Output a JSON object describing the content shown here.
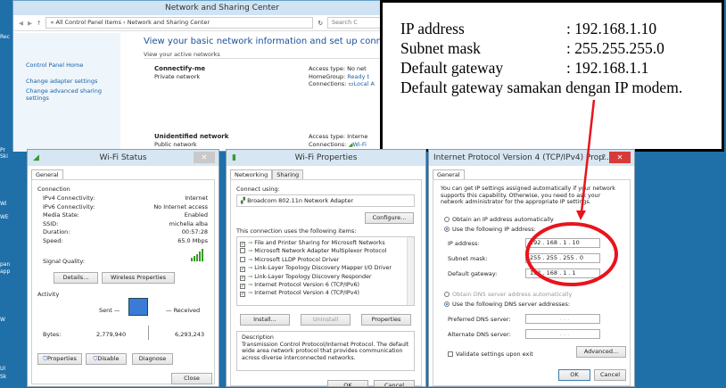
{
  "desktop": {
    "icons": [
      "Rec",
      "Pr",
      "Ski",
      "Wi",
      "WE",
      "pan",
      "app",
      "W",
      "Ul",
      "Sk",
      "Skl"
    ]
  },
  "nsc": {
    "title": "Network and Sharing Center",
    "breadcrumb": "« All Control Panel Items › Network and Sharing Center",
    "search_placeholder": "Search C",
    "left_links": [
      "Control Panel Home",
      "Change adapter settings",
      "Change advanced sharing settings"
    ],
    "heading": "View your basic network information and set up connections",
    "active_label": "View your active networks",
    "networks": [
      {
        "name": "Connectify-me",
        "type": "Private network",
        "access_label": "Access type:",
        "access": "No net",
        "hg_label": "HomeGroup:",
        "hg": "Ready t",
        "conn_label": "Connections:",
        "conn": "Local A"
      },
      {
        "name": "Unidentified network",
        "type": "Public network",
        "access_label": "Access type:",
        "access": "Interne",
        "conn_label": "Connections:",
        "conn": "Wi-Fi"
      }
    ]
  },
  "note": {
    "rows": [
      {
        "k": "IP address",
        "v": ": 192.168.1.10"
      },
      {
        "k": "Subnet mask",
        "v": ": 255.255.255.0"
      },
      {
        "k": "Default gateway",
        "v": ": 192.168.1.1"
      }
    ],
    "remark": "Default gateway samakan dengan IP modem."
  },
  "wifi_status": {
    "title": "Wi-Fi Status",
    "tab": "General",
    "connection_label": "Connection",
    "rows": [
      {
        "k": "IPv4 Connectivity:",
        "v": "Internet"
      },
      {
        "k": "IPv6 Connectivity:",
        "v": "No Internet access"
      },
      {
        "k": "Media State:",
        "v": "Enabled"
      },
      {
        "k": "SSID:",
        "v": "michelia alba"
      },
      {
        "k": "Duration:",
        "v": "00:57:28"
      },
      {
        "k": "Speed:",
        "v": "65.0 Mbps"
      }
    ],
    "signal_label": "Signal Quality:",
    "details_btn": "Details...",
    "wireless_btn": "Wireless Properties",
    "activity_label": "Activity",
    "sent_label": "Sent",
    "received_label": "Received",
    "bytes_label": "Bytes:",
    "bytes_sent": "2,779,940",
    "bytes_received": "6,293,243",
    "properties_btn": "Properties",
    "disable_btn": "Disable",
    "diagnose_btn": "Diagnose",
    "close_btn": "Close"
  },
  "wifi_props": {
    "title": "Wi-Fi Properties",
    "tabs": [
      "Networking",
      "Sharing"
    ],
    "connect_using_label": "Connect using:",
    "adapter": "Broadcom 802.11n Network Adapter",
    "configure_btn": "Configure...",
    "items_label": "This connection uses the following items:",
    "items": [
      {
        "label": "File and Printer Sharing for Microsoft Networks",
        "checked": true
      },
      {
        "label": "Microsoft Network Adapter Multiplexor Protocol",
        "checked": false
      },
      {
        "label": "Microsoft LLDP Protocol Driver",
        "checked": false
      },
      {
        "label": "Link-Layer Topology Discovery Mapper I/O Driver",
        "checked": true
      },
      {
        "label": "Link-Layer Topology Discovery Responder",
        "checked": true
      },
      {
        "label": "Internet Protocol Version 6 (TCP/IPv6)",
        "checked": true
      },
      {
        "label": "Internet Protocol Version 4 (TCP/IPv4)",
        "checked": true
      }
    ],
    "install_btn": "Install...",
    "uninstall_btn": "Uninstall",
    "properties_btn": "Properties",
    "description_label": "Description",
    "description": "Transmission Control Protocol/Internet Protocol. The default wide area network protocol that provides communication across diverse interconnected networks.",
    "ok_btn": "OK",
    "cancel_btn": "Cancel"
  },
  "ipv4": {
    "title": "Internet Protocol Version 4 (TCP/IPv4) Prop...",
    "help": "?",
    "tab": "General",
    "intro": "You can get IP settings assigned automatically if your network supports this capability. Otherwise, you need to ask your network administrator for the appropriate IP settings.",
    "auto_ip": "Obtain an IP address automatically",
    "use_ip": "Use the following IP address:",
    "ip_label": "IP address:",
    "ip_value": "192 . 168 . 1 . 10",
    "mask_label": "Subnet mask:",
    "mask_value": "255 . 255 . 255 . 0",
    "gw_label": "Default gateway:",
    "gw_value": "192 . 168 . 1 . 1",
    "auto_dns": "Obtain DNS server address automatically",
    "use_dns": "Use the following DNS server addresses:",
    "pref_dns_label": "Preferred DNS server:",
    "alt_dns_label": "Alternate DNS server:",
    "dns_blank": ". . .",
    "validate_label": "Validate settings upon exit",
    "advanced_btn": "Advanced...",
    "ok_btn": "OK",
    "cancel_btn": "Cancel"
  },
  "colors": {
    "highlight": "#e8141c",
    "desktop": "#1f6fa8"
  }
}
